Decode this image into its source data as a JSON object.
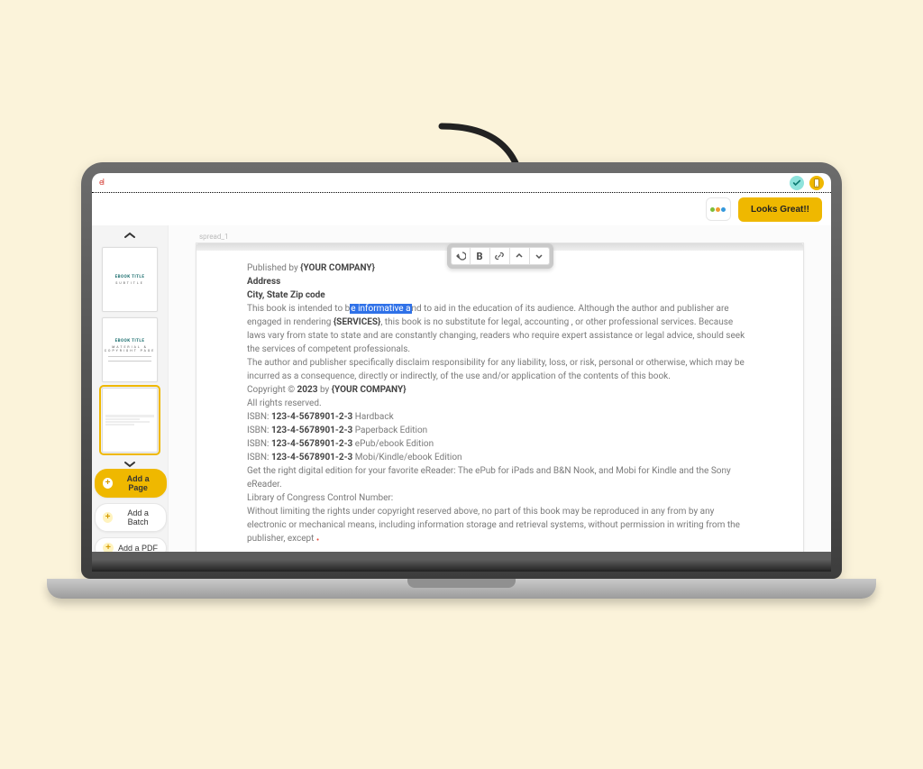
{
  "colors": {
    "accent": "#efb800",
    "highlight": "#2f71e8",
    "background": "#fbf3da"
  },
  "topbar": {
    "left_label": "el"
  },
  "secondbar": {
    "looks_great_label": "Looks Great!!"
  },
  "sidebar": {
    "thumb_title": "EBOOK TITLE",
    "thumb1_sub": "SUBTITLE",
    "thumb2_sub": "MATERIAL & COPYRIGHT PAGE",
    "actions": {
      "add_page": "Add a Page",
      "add_batch": "Add a Batch",
      "add_pdf": "Add a PDF"
    }
  },
  "editor": {
    "page_label": "spread_1",
    "page": {
      "line1_prefix": "Published by ",
      "company_placeholder": "{YOUR COMPANY}",
      "address_label": "Address",
      "city_label": "City, State Zip code",
      "p1_a": "This book is intended to b",
      "p1_highlight": "e informative a",
      "p1_b": "nd to aid in the education of its audience. Although the author and publisher are engaged in rendering ",
      "services_placeholder": "{SERVICES}",
      "p1_c": ", this book is no substitute for legal, accounting , or other professional services. Because laws vary from state to state and are constantly changing, readers who require expert assistance or legal advice, should seek the services of competent professionals.",
      "p2": "The author and publisher specifically disclaim responsibility for any liability, loss, or risk, personal or otherwise, which may be incurred as a consequence, directly or indirectly, of the use and/or application of the contents of this book.",
      "copyright_prefix": "Copyright © ",
      "year": "2023",
      "copyright_mid": " by ",
      "rights": "All rights reserved.",
      "isbn_label": "ISBN: ",
      "isbn": "123-4-5678901-2-3",
      "isbn_fmt1": " Hardback",
      "isbn_fmt2": " Paperback Edition",
      "isbn_fmt3": " ePub/ebook Edition",
      "isbn_fmt4": " Mobi/Kindle/ebook Edition",
      "digital_note": "Get the right digital edition for your favorite eReader: The ePub for iPads and B&N Nook, and Mobi for Kindle and the Sony eReader.",
      "loc_label": "Library of Congress Control Number:",
      "without_limit": "Without limiting the rights under copyright reserved above, no part of this book may be reproduced in any from by any electronic or mechanical means, including information storage and retrieval systems, without permission in writing from the publisher, except"
    }
  }
}
